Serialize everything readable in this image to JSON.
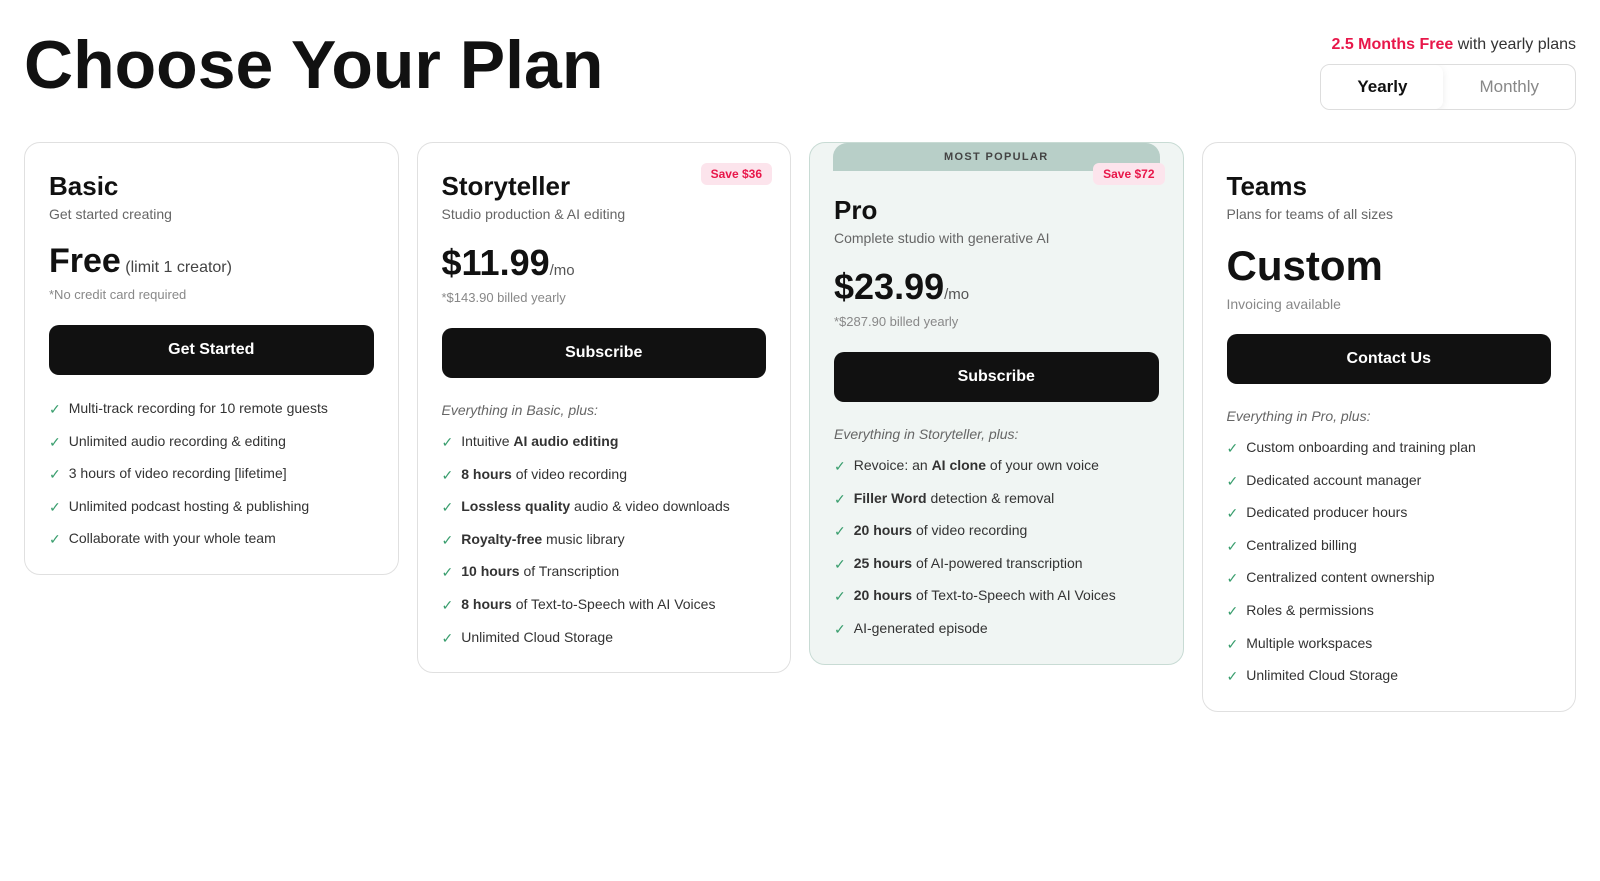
{
  "header": {
    "title": "Choose Your Plan",
    "promo": {
      "highlight": "2.5 Months Free",
      "suffix": " with yearly plans"
    },
    "toggle": {
      "yearly": "Yearly",
      "monthly": "Monthly"
    }
  },
  "plans": [
    {
      "id": "basic",
      "name": "Basic",
      "tagline": "Get started creating",
      "price_display": "Free",
      "price_note": "(limit 1 creator)",
      "billing_note": "*No credit card required",
      "cta": "Get Started",
      "features_label": null,
      "features": [
        "Multi-track recording for 10 remote guests",
        "Unlimited audio recording & editing",
        "3 hours of video recording [lifetime]",
        "Unlimited podcast hosting & publishing",
        "Collaborate with your whole team"
      ],
      "features_bold": []
    },
    {
      "id": "storyteller",
      "name": "Storyteller",
      "tagline": "Studio production & AI editing",
      "price_amount": "$11.99",
      "price_period": "/mo",
      "billing_note": "*$143.90 billed yearly",
      "cta": "Subscribe",
      "save_badge": "Save $36",
      "features_label": "Everything in Basic, plus:",
      "features": [
        "Intuitive <b>AI audio editing</b>",
        "<b>8 hours</b> of video recording",
        "<b>Lossless quality</b> audio & video downloads",
        "<b>Royalty-free</b> music library",
        "<b>10 hours</b> of Transcription",
        "<b>8 hours</b> of Text-to-Speech with AI Voices",
        "Unlimited Cloud Storage"
      ]
    },
    {
      "id": "pro",
      "name": "Pro",
      "tagline": "Complete studio with generative AI",
      "price_amount": "$23.99",
      "price_period": "/mo",
      "billing_note": "*$287.90 billed yearly",
      "cta": "Subscribe",
      "save_badge": "Save $72",
      "popular": true,
      "popular_label": "MOST POPULAR",
      "features_label": "Everything in Storyteller, plus:",
      "features": [
        "Revoice: an <b>AI clone</b> of your own voice",
        "<b>Filler Word</b> detection & removal",
        "<b>20 hours</b> of video recording",
        "<b>25 hours</b> of AI-powered transcription",
        "<b>20 hours</b> of Text-to-Speech with AI Voices",
        "AI-generated episode"
      ]
    },
    {
      "id": "teams",
      "name": "Teams",
      "tagline": "Plans for teams of all sizes",
      "price_custom": "Custom",
      "invoicing_note": "Invoicing available",
      "cta": "Contact Us",
      "features_label": "Everything in Pro, plus:",
      "features": [
        "Custom onboarding and training plan",
        "Dedicated account manager",
        "Dedicated producer hours",
        "Centralized billing",
        "Centralized content ownership",
        "Roles & permissions",
        "Multiple workspaces",
        "Unlimited Cloud Storage"
      ]
    }
  ]
}
